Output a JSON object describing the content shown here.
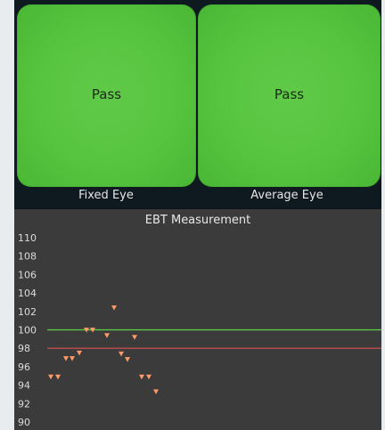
{
  "tiles": [
    {
      "result": "Pass",
      "label": "Fixed Eye"
    },
    {
      "result": "Pass",
      "label": "Average Eye"
    }
  ],
  "colors": {
    "pass_green": "#57c43f",
    "chart_bg": "#3b3b3b",
    "reference_green": "#5fcf4a",
    "reference_red": "#d9534f",
    "marker": "#ff9a66"
  },
  "chart_data": {
    "type": "scatter",
    "title": "EBT Measurement",
    "ylim": [
      90,
      110
    ],
    "yticks": [
      110,
      108,
      106,
      104,
      102,
      100,
      98,
      96,
      94,
      92,
      90
    ],
    "reference_lines": [
      {
        "y": 100,
        "color": "#5fcf4a"
      },
      {
        "y": 98,
        "color": "#d9534f"
      }
    ],
    "series": [
      {
        "marker": "triangle-down",
        "color": "#ff9a66",
        "points": [
          {
            "x": 1,
            "y": 94.9
          },
          {
            "x": 2,
            "y": 94.9
          },
          {
            "x": 3,
            "y": 96.9
          },
          {
            "x": 4,
            "y": 96.9
          },
          {
            "x": 5,
            "y": 97.5
          },
          {
            "x": 6,
            "y": 100.0
          },
          {
            "x": 7,
            "y": 100.0
          },
          {
            "x": 8,
            "y": 99.4
          },
          {
            "x": 9,
            "y": 102.4
          },
          {
            "x": 10,
            "y": 97.4
          },
          {
            "x": 11,
            "y": 96.8
          },
          {
            "x": 12,
            "y": 99.2
          },
          {
            "x": 13,
            "y": 94.9
          },
          {
            "x": 14,
            "y": 94.9
          },
          {
            "x": 15,
            "y": 93.3
          }
        ]
      }
    ]
  }
}
